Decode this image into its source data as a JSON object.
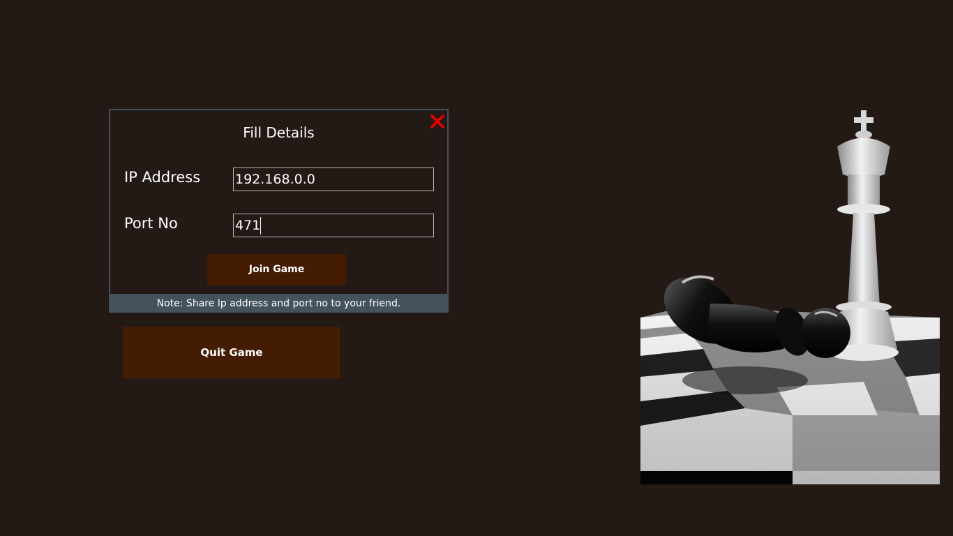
{
  "dialog": {
    "title": "Fill Details",
    "ip_label": "IP Address",
    "ip_value": "192.168.0.0",
    "port_label": "Port No",
    "port_value": "471",
    "join_label": "Join Game",
    "note": "Note: Share Ip address and port no to your friend.",
    "close_icon": "close-x-icon",
    "close_color": "#e00000"
  },
  "quit_label": "Quit Game",
  "colors": {
    "background": "#231915",
    "button": "#441c02",
    "accent_bar": "#44525c"
  }
}
